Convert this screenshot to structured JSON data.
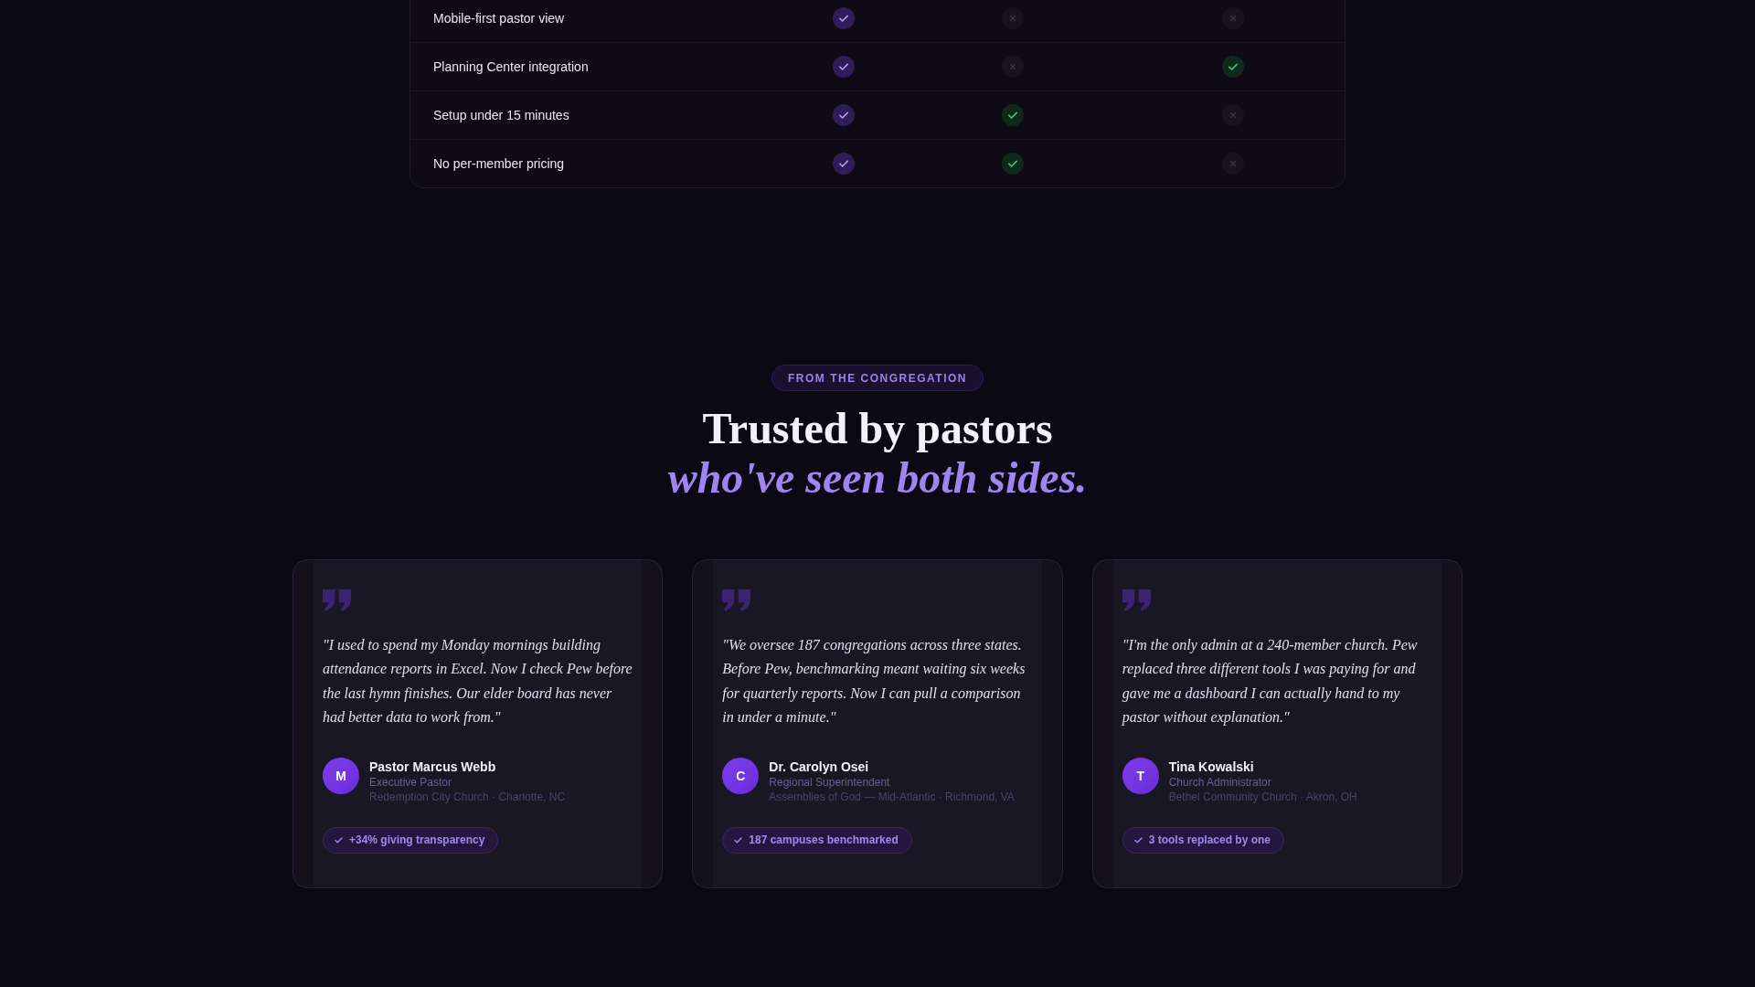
{
  "comparison": {
    "rows": [
      {
        "feature": "Mobile-first pastor view",
        "checks": [
          true,
          false,
          false
        ]
      },
      {
        "feature": "Planning Center integration",
        "checks": [
          true,
          false,
          true
        ]
      },
      {
        "feature": "Setup under 15 minutes",
        "checks": [
          true,
          true,
          false
        ]
      },
      {
        "feature": "No per-member pricing",
        "checks": [
          true,
          true,
          false
        ]
      }
    ]
  },
  "testimonials": {
    "eyebrow": "FROM THE CONGREGATION",
    "title": "Trusted by pastors",
    "title_accent": "who've seen both sides.",
    "cards": [
      {
        "quote": "\"I used to spend my Monday mornings building attendance reports in Excel. Now I check Pew before the last hymn finishes. Our elder board has never had better data to work from.\"",
        "initial": "M",
        "name": "Pastor Marcus Webb",
        "role": "Executive Pastor",
        "organization": "Redemption City Church · Charlotte, NC",
        "highlight": "+34% giving transparency"
      },
      {
        "quote": "\"We oversee 187 congregations across three states. Before Pew, benchmarking meant waiting six weeks for quarterly reports. Now I can pull a comparison in under a minute.\"",
        "initial": "C",
        "name": "Dr. Carolyn Osei",
        "role": "Regional Superintendent",
        "organization": "Assemblies of God — Mid-Atlantic · Richmond, VA",
        "highlight": "187 campuses benchmarked"
      },
      {
        "quote": "\"I'm the only admin at a 240-member church. Pew replaced three different tools I was paying for and gave me a dashboard I can actually hand to my pastor without explanation.\"",
        "initial": "T",
        "name": "Tina Kowalski",
        "role": "Church Administrator",
        "organization": "Bethel Community Church · Akron, OH",
        "highlight": "3 tools replaced by one"
      }
    ]
  }
}
